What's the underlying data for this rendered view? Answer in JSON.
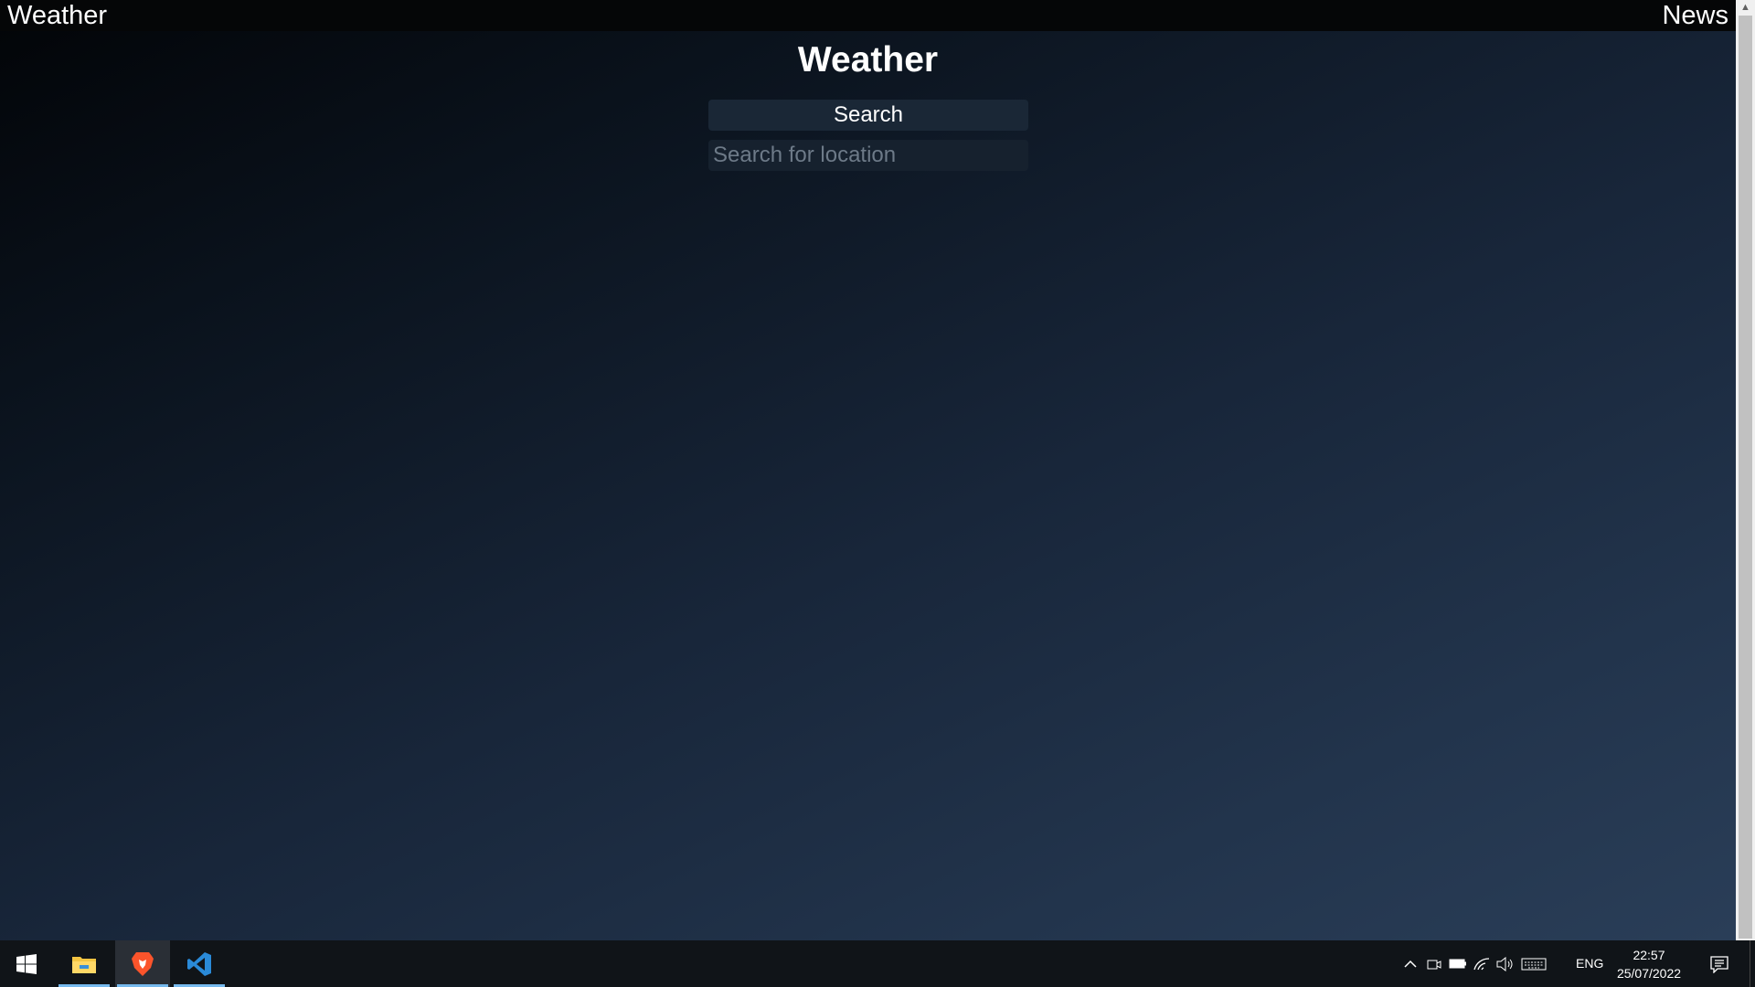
{
  "nav": {
    "left_label": "Weather",
    "right_label": "News"
  },
  "main": {
    "title": "Weather",
    "search_button_label": "Search",
    "search_placeholder": "Search for location",
    "search_value": ""
  },
  "taskbar": {
    "apps": [
      {
        "name": "start-icon"
      },
      {
        "name": "file-explorer-icon"
      },
      {
        "name": "brave-browser-icon",
        "active": true
      },
      {
        "name": "vscode-icon"
      }
    ],
    "tray": {
      "language": "ENG",
      "time": "22:57",
      "date": "25/07/2022"
    }
  },
  "colors": {
    "bg_dark": "#020407",
    "bg_light": "#2a3e58",
    "topbar": "#050607",
    "button": "#1a2736",
    "input": "#16212e",
    "taskbar": "#101418",
    "taskbar_accent": "#76b9ed"
  }
}
